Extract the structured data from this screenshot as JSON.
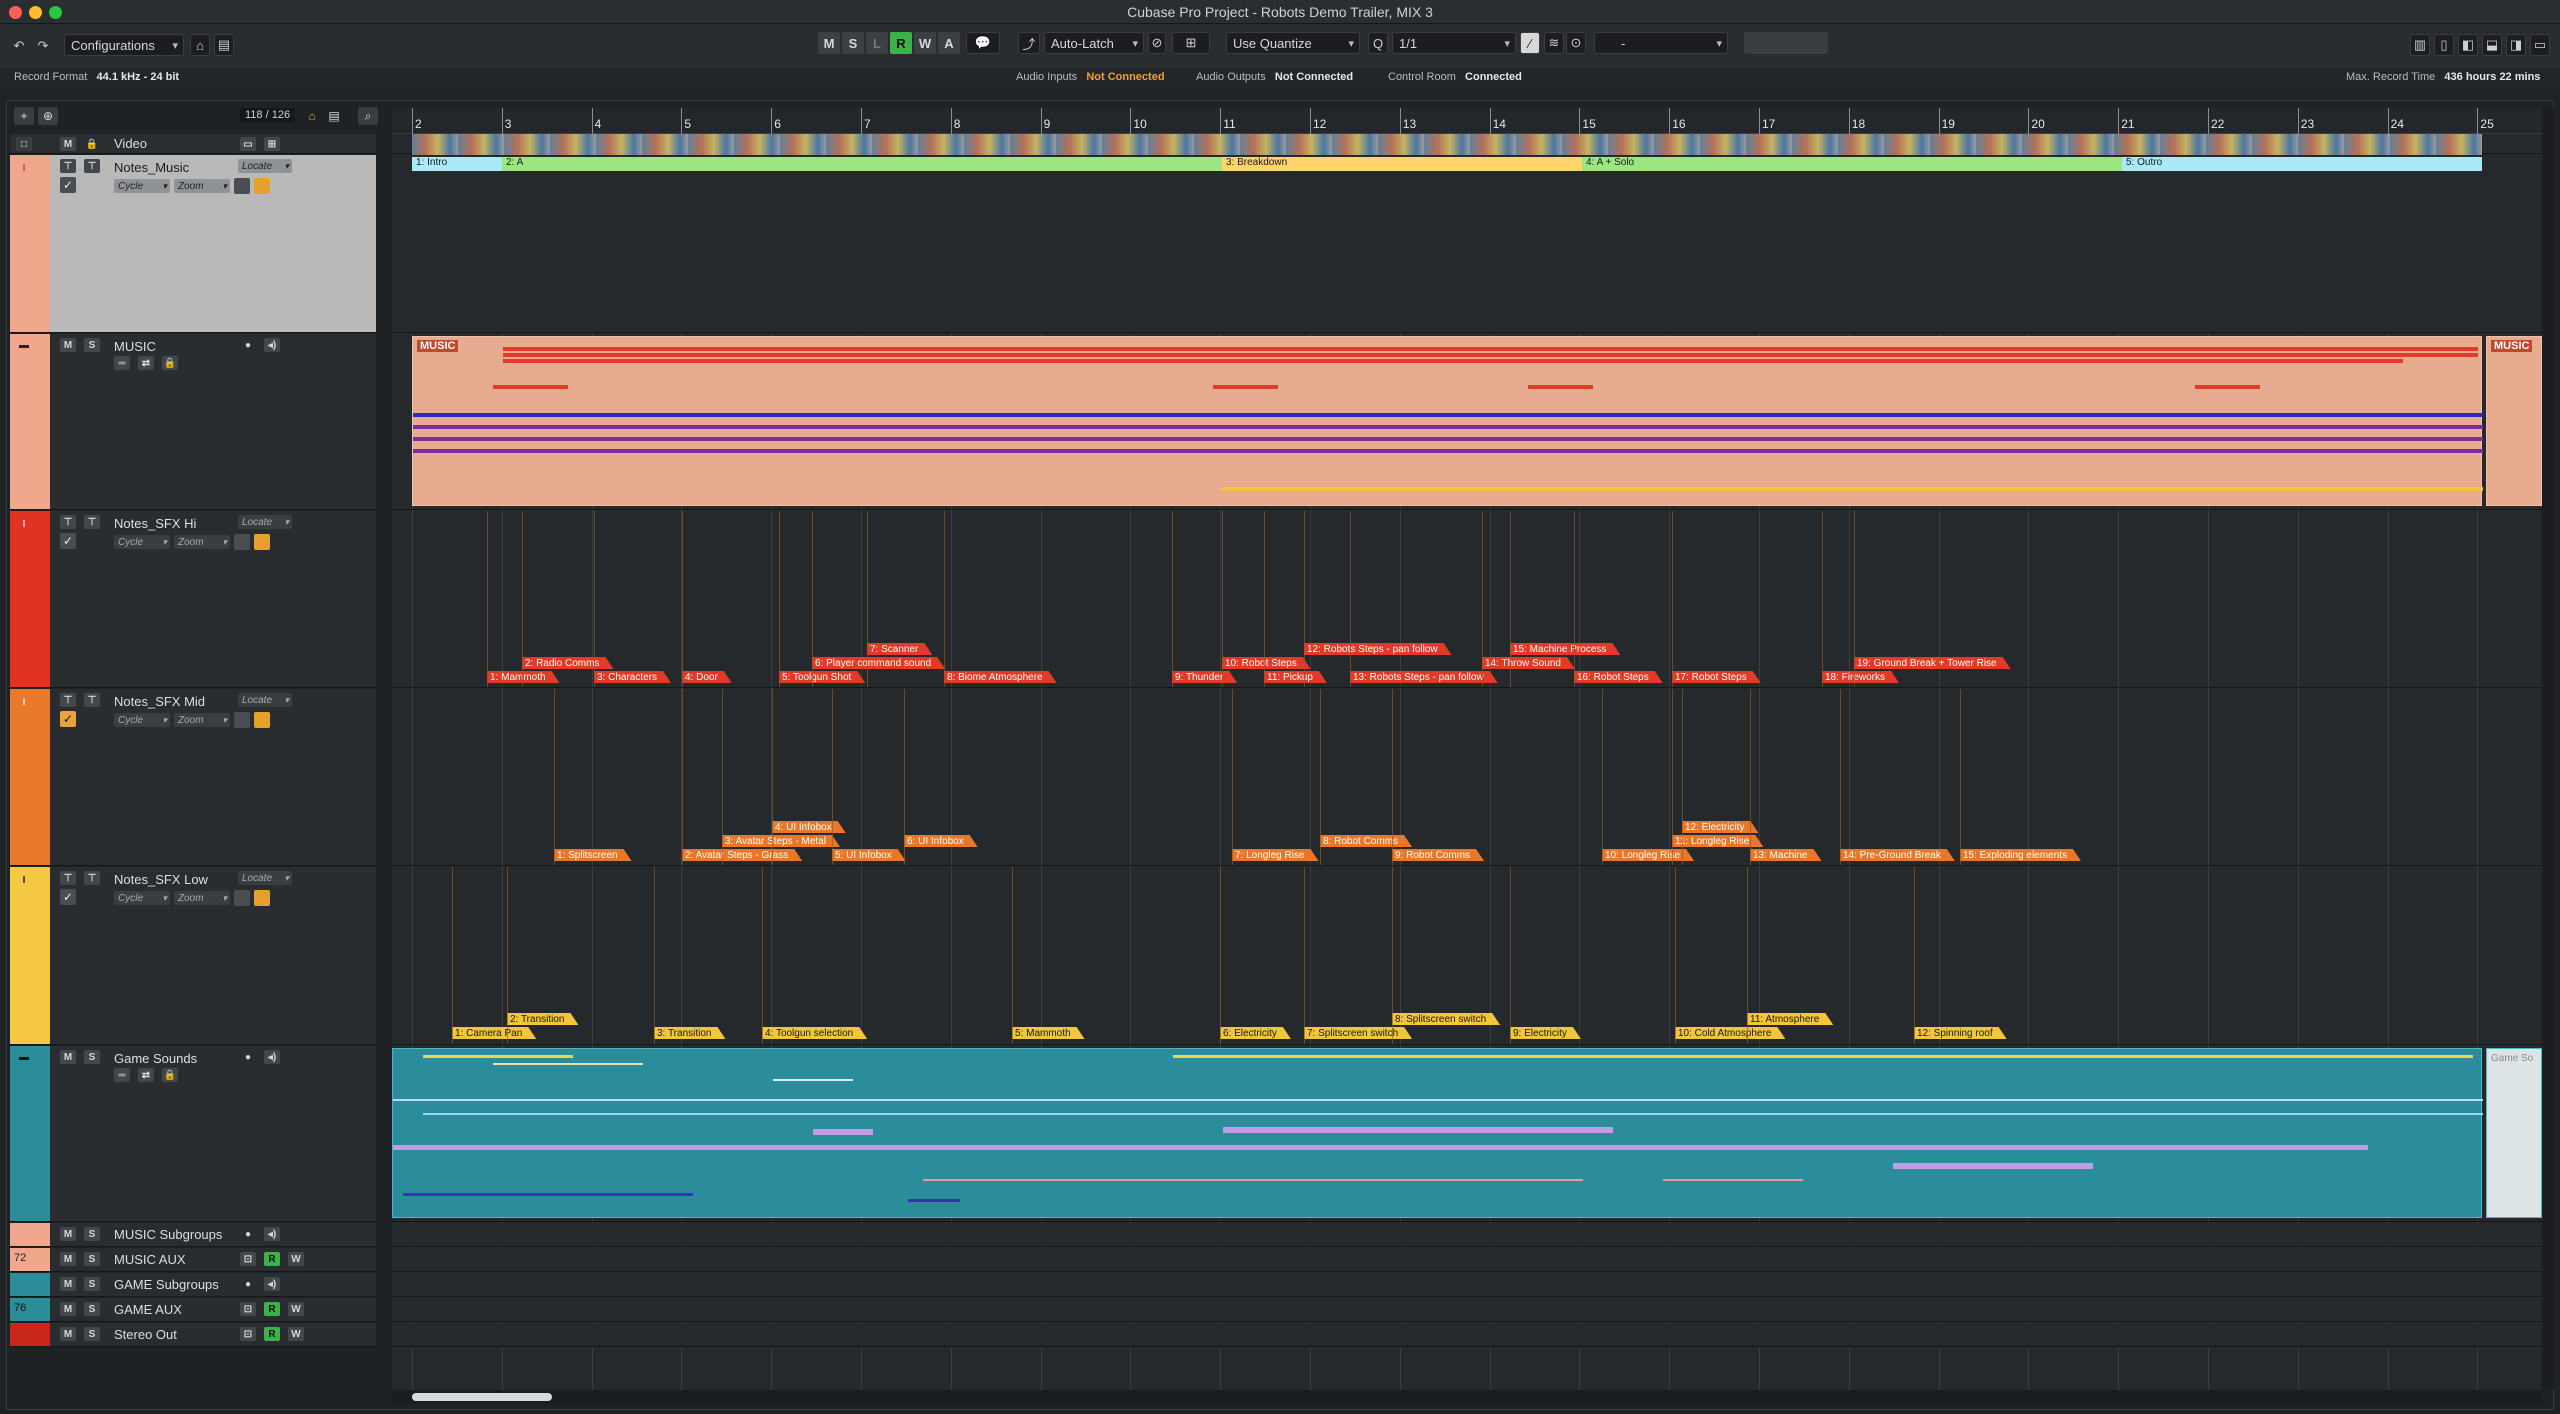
{
  "window": {
    "title": "Cubase Pro Project - Robots Demo Trailer, MIX 3"
  },
  "toolbar": {
    "configurations": "Configurations",
    "msr_buttons": [
      "M",
      "S",
      "L",
      "R",
      "W",
      "A"
    ],
    "automation_mode": "Auto-Latch",
    "quantize_mode": "Use Quantize",
    "quantize_value": "1/1",
    "nudge_value": "-"
  },
  "infoline": {
    "record_format_label": "Record Format",
    "record_format_value": "44.1 kHz - 24 bit",
    "audio_inputs_label": "Audio Inputs",
    "audio_inputs_value": "Not Connected",
    "audio_outputs_label": "Audio Outputs",
    "audio_outputs_value": "Not Connected",
    "control_room_label": "Control Room",
    "control_room_value": "Connected",
    "max_record_label": "Max. Record Time",
    "max_record_value": "436 hours 22 mins"
  },
  "project": {
    "track_count": "118 / 126"
  },
  "ruler": {
    "bars": [
      "2",
      "3",
      "4",
      "5",
      "6",
      "7",
      "8",
      "9",
      "10",
      "11",
      "12",
      "13",
      "14",
      "15",
      "16",
      "17",
      "18",
      "19",
      "20",
      "21",
      "22",
      "23",
      "24",
      "25"
    ]
  },
  "tracks": {
    "video": "Video",
    "notes_music": {
      "name": "Notes_Music",
      "locate": "Locate",
      "cycle": "Cycle",
      "zoom": "Zoom"
    },
    "music": {
      "name": "MUSIC",
      "part": "MUSIC"
    },
    "sfx_hi": {
      "name": "Notes_SFX Hi",
      "locate": "Locate",
      "cycle": "Cycle",
      "zoom": "Zoom"
    },
    "sfx_mid": {
      "name": "Notes_SFX Mid",
      "locate": "Locate",
      "cycle": "Cycle",
      "zoom": "Zoom"
    },
    "sfx_low": {
      "name": "Notes_SFX Low",
      "locate": "Locate",
      "cycle": "Cycle",
      "zoom": "Zoom"
    },
    "game_sounds": {
      "name": "Game Sounds",
      "part": "Game So"
    },
    "music_subgroups": "MUSIC Subgroups",
    "music_aux": {
      "name": "MUSIC AUX",
      "number": "72"
    },
    "game_subgroups": "GAME Subgroups",
    "game_aux": {
      "name": "GAME AUX",
      "number": "76"
    },
    "stereo_out": "Stereo Out"
  },
  "markers": [
    {
      "label": "1: Intro"
    },
    {
      "label": "2: A"
    },
    {
      "label": "3: Breakdown"
    },
    {
      "label": "4: A + Solo"
    },
    {
      "label": "5: Outro"
    }
  ],
  "sfx_hi_events": [
    "1: Mammoth",
    "2: Radio Comms",
    "3: Characters",
    "4: Door",
    "5: Toolgun Shot",
    "6: Player command sound",
    "7: Scanner",
    "8: Biome Atmosphere",
    "9: Thunder",
    "10: Robot Steps",
    "11: Pickup",
    "12: Robots Steps - pan follow",
    "13: Robots Steps - pan follow",
    "14: Throw  Sound",
    "15: Machine Process",
    "16: Robot Steps",
    "17: Robot Steps",
    "18: Fireworks",
    "19: Ground Break + Tower Rise"
  ],
  "sfx_mid_events": [
    "1: Splitscreen",
    "2: Avatar Steps - Grass",
    "3: Avatar Steps - Metal",
    "4: UI Infobox",
    "5: UI Infobox",
    "6: UI Infobox",
    "7: Longleg Rise",
    "8: Robot Comms",
    "9: Robot Comms",
    "10: Longleg Rise",
    "11: Longleg Rise",
    "12: Electricity",
    "13: Machine",
    "14: Pre-Ground Break",
    "15: Exploding elements"
  ],
  "sfx_low_events": [
    "1: Camera Pan",
    "2: Transition",
    "3: Transition",
    "4: Toolgun selection",
    "5: Mammoth",
    "6: Electricity",
    "7: Splitscreen switch",
    "8: Splitscreen switch",
    "9: Electricity",
    "10: Cold Atmosphere",
    "11: Atmosphere",
    "12: Spinning roof"
  ],
  "colors": {
    "accent_green": "#3bb34a",
    "warn": "#f0a030",
    "music": "#e7ac90",
    "game": "#2b8d9a"
  }
}
